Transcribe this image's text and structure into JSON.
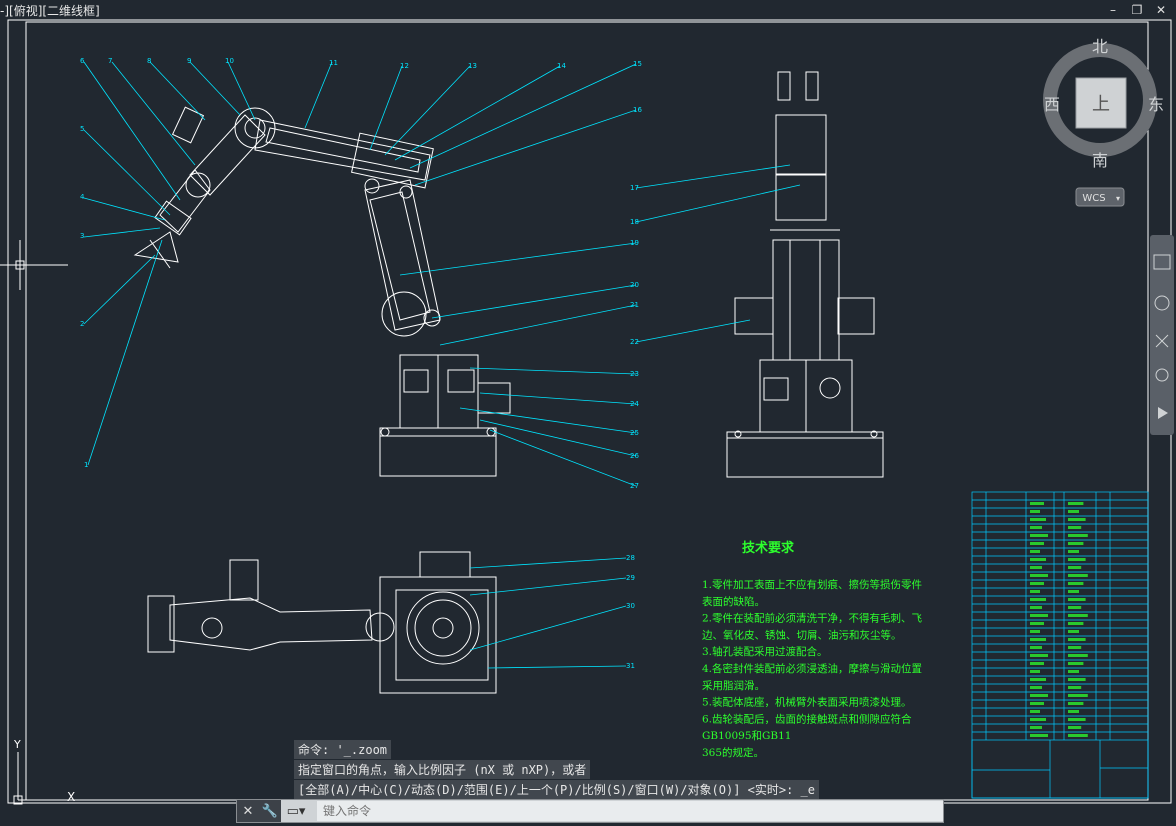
{
  "viewport": {
    "label": "-][俯视][二维线框]"
  },
  "window_controls": {
    "minimize": "–",
    "restore": "❐",
    "close": "✕"
  },
  "viewcube": {
    "north": "北",
    "south": "南",
    "east": "东",
    "west": "西",
    "top": "上",
    "wcs": "WCS"
  },
  "command_history": [
    "命令: '_.zoom",
    "指定窗口的角点，输入比例因子 (nX 或 nXP)，或者",
    "[全部(A)/中心(C)/动态(D)/范围(E)/上一个(P)/比例(S)/窗口(W)/对象(O)] <实时>: _e"
  ],
  "command_input": {
    "placeholder": "键入命令"
  },
  "ucs": {
    "y": "Y",
    "x": "X"
  },
  "tech_requirements": {
    "title": "技术要求",
    "lines": [
      "1.零件加工表面上不应有划痕、擦伤等损伤零件",
      "表面的缺陷。",
      "2.零件在装配前必须清洗干净，不得有毛刺、飞",
      "边、氧化皮、锈蚀、切屑、油污和灰尘等。",
      "3.轴孔装配采用过渡配合。",
      "4.各密封件装配前必须浸透油，摩擦与滑动位置",
      "采用脂润滑。",
      "5.装配体底座，机械臂外表面采用喷漆处理。",
      "6.齿轮装配后，齿面的接触斑点和侧隙应符合",
      "GB10095和GB11",
      "365的规定。"
    ]
  },
  "balloons_left": [
    "6",
    "7",
    "8",
    "9",
    "10",
    "5",
    "4",
    "3",
    "2",
    "1"
  ],
  "balloons_top": [
    "11",
    "12",
    "13",
    "14",
    "15",
    "16"
  ],
  "balloons_right_side": [
    "17",
    "18",
    "19",
    "20",
    "21",
    "22",
    "23",
    "24",
    "25",
    "26",
    "27"
  ],
  "balloons_plan": [
    "28",
    "29",
    "30",
    "31"
  ],
  "colors": {
    "background": "#212830",
    "outline": "#ffffff",
    "leader": "#00e5ff",
    "text_green": "#2dff2d",
    "table": "#00c8ff"
  }
}
